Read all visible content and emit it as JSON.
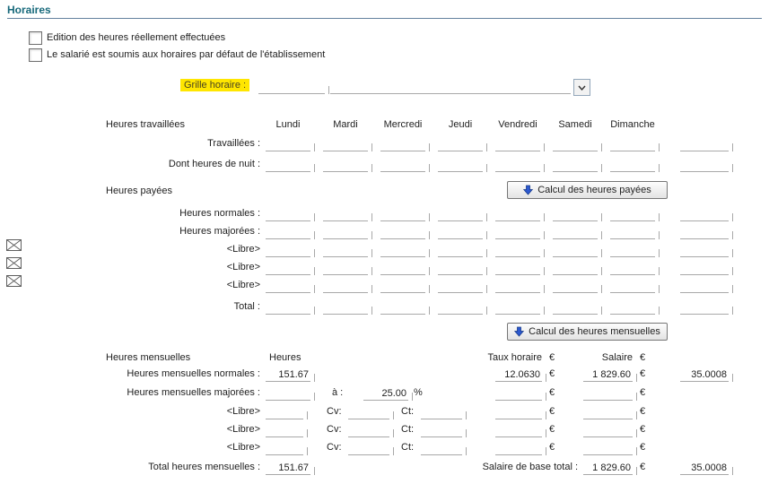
{
  "header": {
    "title": "Horaires"
  },
  "options": {
    "edit_real_hours": "Edition des heures réellement effectuées",
    "default_schedule": "Le salarié est soumis aux horaires par défaut de l'établissement"
  },
  "grille": {
    "label": "Grille horaire :",
    "code_value": "",
    "name_value": ""
  },
  "colors": {
    "accent": "#17697b",
    "highlight": "#ffe600",
    "arrow_icon": "#2d59cf"
  },
  "day_table": {
    "section_title": "Heures travaillées",
    "days": [
      "Lundi",
      "Mardi",
      "Mercredi",
      "Jeudi",
      "Vendredi",
      "Samedi",
      "Dimanche"
    ],
    "row_travaillees": "Travaillées :",
    "row_nuit": "Dont heures de nuit :",
    "paid_title": "Heures payées",
    "paid_button": "Calcul des heures payées",
    "row_normales": "Heures normales :",
    "row_majorees": "Heures majorées :",
    "row_libre": "<Libre>",
    "row_total": "Total :"
  },
  "monthly": {
    "button": "Calcul des heures mensuelles",
    "section_title": "Heures mensuelles",
    "col_heures": "Heures",
    "col_taux": "Taux horaire",
    "col_salaire": "Salaire",
    "euro": "€",
    "percent": "%",
    "normales": {
      "label": "Heures mensuelles normales :",
      "heures": "151.67",
      "taux": "12.0630",
      "salaire": "1 829.60",
      "coef": "35.0008"
    },
    "majorees": {
      "label": "Heures mensuelles majorées :",
      "a_label": "à :",
      "rate": "25.00"
    },
    "libre_label": "<Libre>",
    "cv_label": "Cv:",
    "ct_label": "Ct:",
    "total": {
      "label": "Total heures mensuelles :",
      "heures": "151.67",
      "salaire_label": "Salaire de base total :",
      "salaire": "1 829.60",
      "coef": "35.0008"
    }
  }
}
